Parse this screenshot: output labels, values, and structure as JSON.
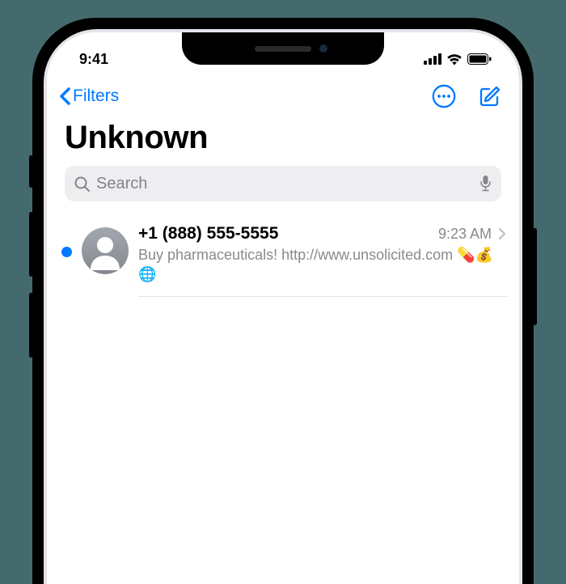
{
  "status": {
    "time": "9:41"
  },
  "nav": {
    "back_label": "Filters"
  },
  "page": {
    "title": "Unknown"
  },
  "search": {
    "placeholder": "Search"
  },
  "messages": [
    {
      "sender": "+1 (888) 555-5555",
      "timestamp": "9:23 AM",
      "preview": "Buy pharmaceuticals! http://www.unsolicited.com 💊💰🌐",
      "unread": true
    }
  ]
}
